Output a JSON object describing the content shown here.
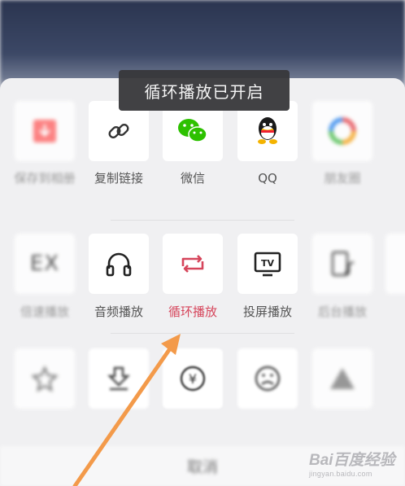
{
  "toast": {
    "text": "循环播放已开启"
  },
  "share_row": [
    {
      "label": "保存到相册",
      "icon": "save-to-album-icon",
      "blurred": true
    },
    {
      "label": "复制链接",
      "icon": "link-icon",
      "blurred": false
    },
    {
      "label": "微信",
      "icon": "wechat-icon",
      "blurred": false
    },
    {
      "label": "QQ",
      "icon": "qq-icon",
      "blurred": false
    },
    {
      "label": "朋友圈",
      "icon": "moments-icon",
      "blurred": true
    }
  ],
  "action_row": [
    {
      "label": "倍速播放",
      "icon": "speed-ex-icon",
      "icon_text": "EX",
      "blurred": true
    },
    {
      "label": "音频播放",
      "icon": "headphones-icon",
      "blurred": false
    },
    {
      "label": "循环播放",
      "icon": "loop-icon",
      "blurred": false,
      "active": true
    },
    {
      "label": "投屏播放",
      "icon": "tv-cast-icon",
      "icon_text": "TV",
      "blurred": false
    },
    {
      "label": "后台播放",
      "icon": "background-play-icon",
      "blurred": true
    }
  ],
  "bottom_row": [
    {
      "icon": "star-icon"
    },
    {
      "icon": "download-icon"
    },
    {
      "icon": "yuan-icon",
      "icon_text": "¥"
    },
    {
      "icon": "sad-face-icon"
    },
    {
      "icon": "triangle-warning-icon"
    }
  ],
  "cancel": {
    "label": "取消"
  },
  "watermark": {
    "brand": "Bai百度经验",
    "url": "jingyan.baidu.com"
  },
  "colors": {
    "active": "#d6455b",
    "toast_bg": "#37373a",
    "arrow": "#f39a4a",
    "wechat": "#2dc100"
  }
}
